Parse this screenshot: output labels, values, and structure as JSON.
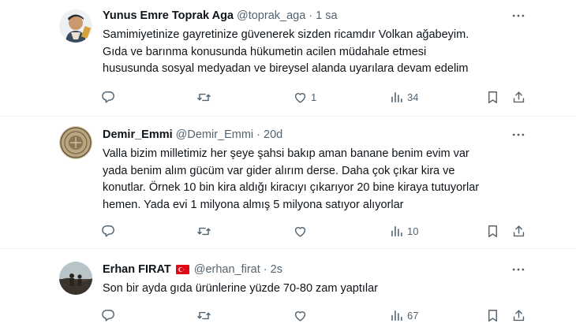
{
  "tweets": [
    {
      "name": "Yunus Emre Toprak Aga",
      "handle": "@toprak_aga",
      "time": "1 sa",
      "lines": [
        "Samimiyetinize gayretinize güvenerek sizden ricamdır Volkan ağabeyim.",
        "Gıda ve barınma konusunda hükumetin acilen müdahale etmesi",
        "hususunda sosyal medyadan ve bireysel alanda uyarılara devam edelim"
      ],
      "likes": "1",
      "views": "34"
    },
    {
      "name": "Demir_Emmi",
      "handle": "@Demir_Emmi",
      "time": "20d",
      "lines": [
        "Valla bizim milletimiz her şeye şahsi bakıp aman banane benim evim var",
        "yada benim alım gücüm var gider alırım derse. Daha çok çıkar kira ve",
        "konutlar.  Örnek 10 bin kira aldığı kiracıyı çıkarıyor 20 bine kiraya tutuyorlar",
        "hemen. Yada evi 1 milyona almış 5 milyona satıyor alıyorlar"
      ],
      "views": "10"
    },
    {
      "name": "Erhan FIRAT",
      "handle": "@erhan_firat",
      "time": "2s",
      "lines": [
        "Son bir ayda gıda ürünlerine yüzde 70-80 zam yaptılar"
      ],
      "views": "67"
    }
  ],
  "icons": {
    "reply": "reply-icon",
    "retweet": "retweet-icon",
    "like": "heart-icon",
    "views": "views-icon",
    "bookmark": "bookmark-icon",
    "share": "share-icon",
    "more": "more-icon",
    "flag": "turkey-flag-icon"
  },
  "colors": {
    "text": "#0f1419",
    "secondary": "#536471",
    "divider": "#eff3f4",
    "flag": "#e30a17"
  }
}
